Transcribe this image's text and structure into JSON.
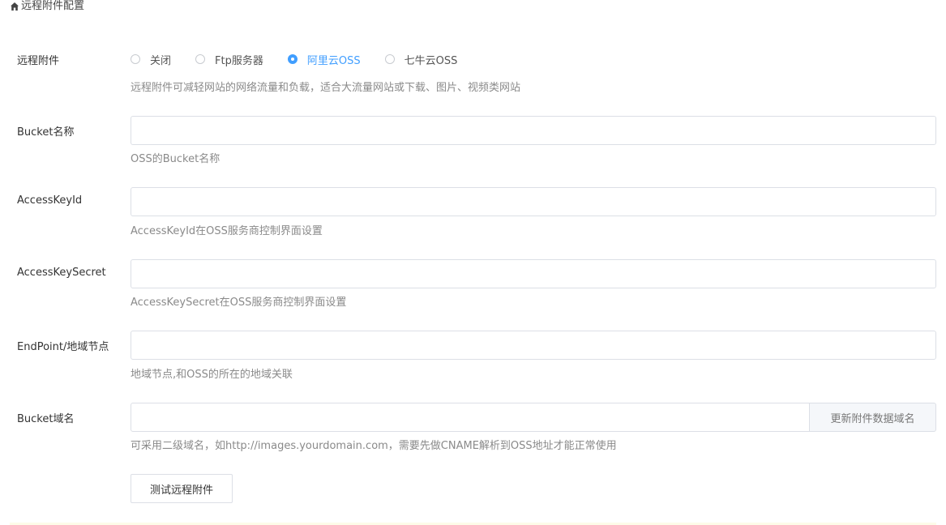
{
  "breadcrumb": {
    "icon": "home-icon",
    "title": "远程附件配置"
  },
  "remote_attachment": {
    "label": "远程附件",
    "options": [
      {
        "label": "关闭",
        "checked": false
      },
      {
        "label": "Ftp服务器",
        "checked": false
      },
      {
        "label": "阿里云OSS",
        "checked": true
      },
      {
        "label": "七牛云OSS",
        "checked": false
      }
    ],
    "help": "远程附件可减轻网站的网络流量和负载，适合大流量网站或下载、图片、视频类网站"
  },
  "bucket_name": {
    "label": "Bucket名称",
    "value": "",
    "help": "OSS的Bucket名称"
  },
  "access_key_id": {
    "label": "AccessKeyId",
    "value": "",
    "help": "AccessKeyId在OSS服务商控制界面设置"
  },
  "access_key_secret": {
    "label": "AccessKeySecret",
    "value": "",
    "help": "AccessKeySecret在OSS服务商控制界面设置"
  },
  "endpoint": {
    "label": "EndPoint/地域节点",
    "value": "",
    "help": "地域节点,和OSS的所在的地域关联"
  },
  "bucket_domain": {
    "label": "Bucket域名",
    "value": "",
    "button_label": "更新附件数据域名",
    "help": "可采用二级域名，如http://images.yourdomain.com，需要先做CNAME解析到OSS地址才能正常使用"
  },
  "actions": {
    "test_button_label": "测试远程附件"
  },
  "colors": {
    "accent": "#409eff",
    "border": "#dcdfe6",
    "help_text": "#8a8a8a",
    "addon_bg": "#f5f7fa"
  }
}
